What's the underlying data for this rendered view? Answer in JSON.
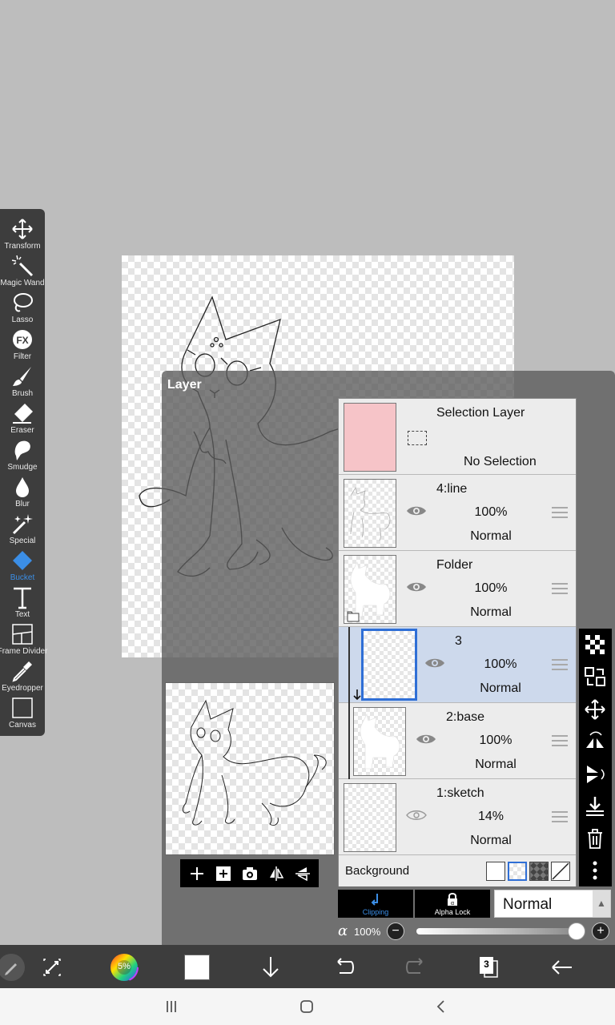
{
  "toolbar": {
    "tools": [
      {
        "label": "Transform",
        "icon": "move-arrows-icon"
      },
      {
        "label": "Magic Wand",
        "icon": "magic-wand-icon"
      },
      {
        "label": "Lasso",
        "icon": "lasso-icon"
      },
      {
        "label": "Filter",
        "icon": "fx-icon"
      },
      {
        "label": "Brush",
        "icon": "brush-icon"
      },
      {
        "label": "Eraser",
        "icon": "eraser-icon"
      },
      {
        "label": "Smudge",
        "icon": "smudge-icon"
      },
      {
        "label": "Blur",
        "icon": "droplet-icon"
      },
      {
        "label": "Special",
        "icon": "sparkle-icon"
      },
      {
        "label": "Bucket",
        "icon": "bucket-icon",
        "active": true
      },
      {
        "label": "Text",
        "icon": "text-icon"
      },
      {
        "label": "Frame Divider",
        "icon": "frame-divider-icon"
      },
      {
        "label": "Eyedropper",
        "icon": "eyedropper-icon"
      },
      {
        "label": "Canvas",
        "icon": "canvas-icon"
      }
    ]
  },
  "layer_panel": {
    "title": "Layer",
    "selection_layer": {
      "name": "Selection Layer",
      "status": "No Selection"
    },
    "layers": [
      {
        "name": "4:line",
        "opacity": "100%",
        "mode": "Normal",
        "visible": true
      },
      {
        "name": "Folder",
        "opacity": "100%",
        "mode": "Normal",
        "visible": true
      },
      {
        "name": "3",
        "opacity": "100%",
        "mode": "Normal",
        "visible": true,
        "selected": true
      },
      {
        "name": "2:base",
        "opacity": "100%",
        "mode": "Normal",
        "visible": true
      },
      {
        "name": "1:sketch",
        "opacity": "14%",
        "mode": "Normal",
        "visible": false
      }
    ],
    "background_label": "Background",
    "clipping_label": "Clipping",
    "alpha_lock_label": "Alpha Lock",
    "blend_mode": "Normal",
    "alpha_label": "100%",
    "alpha_value": 1.0
  },
  "bottom_bar": {
    "color_wheel_label": "5%",
    "layers_count": "3",
    "primary_color": "#ffffff"
  },
  "colors": {
    "accent": "#3b8ee6",
    "selected_row": "#cdd9ec",
    "selection_thumb": "#f6c4c8"
  }
}
